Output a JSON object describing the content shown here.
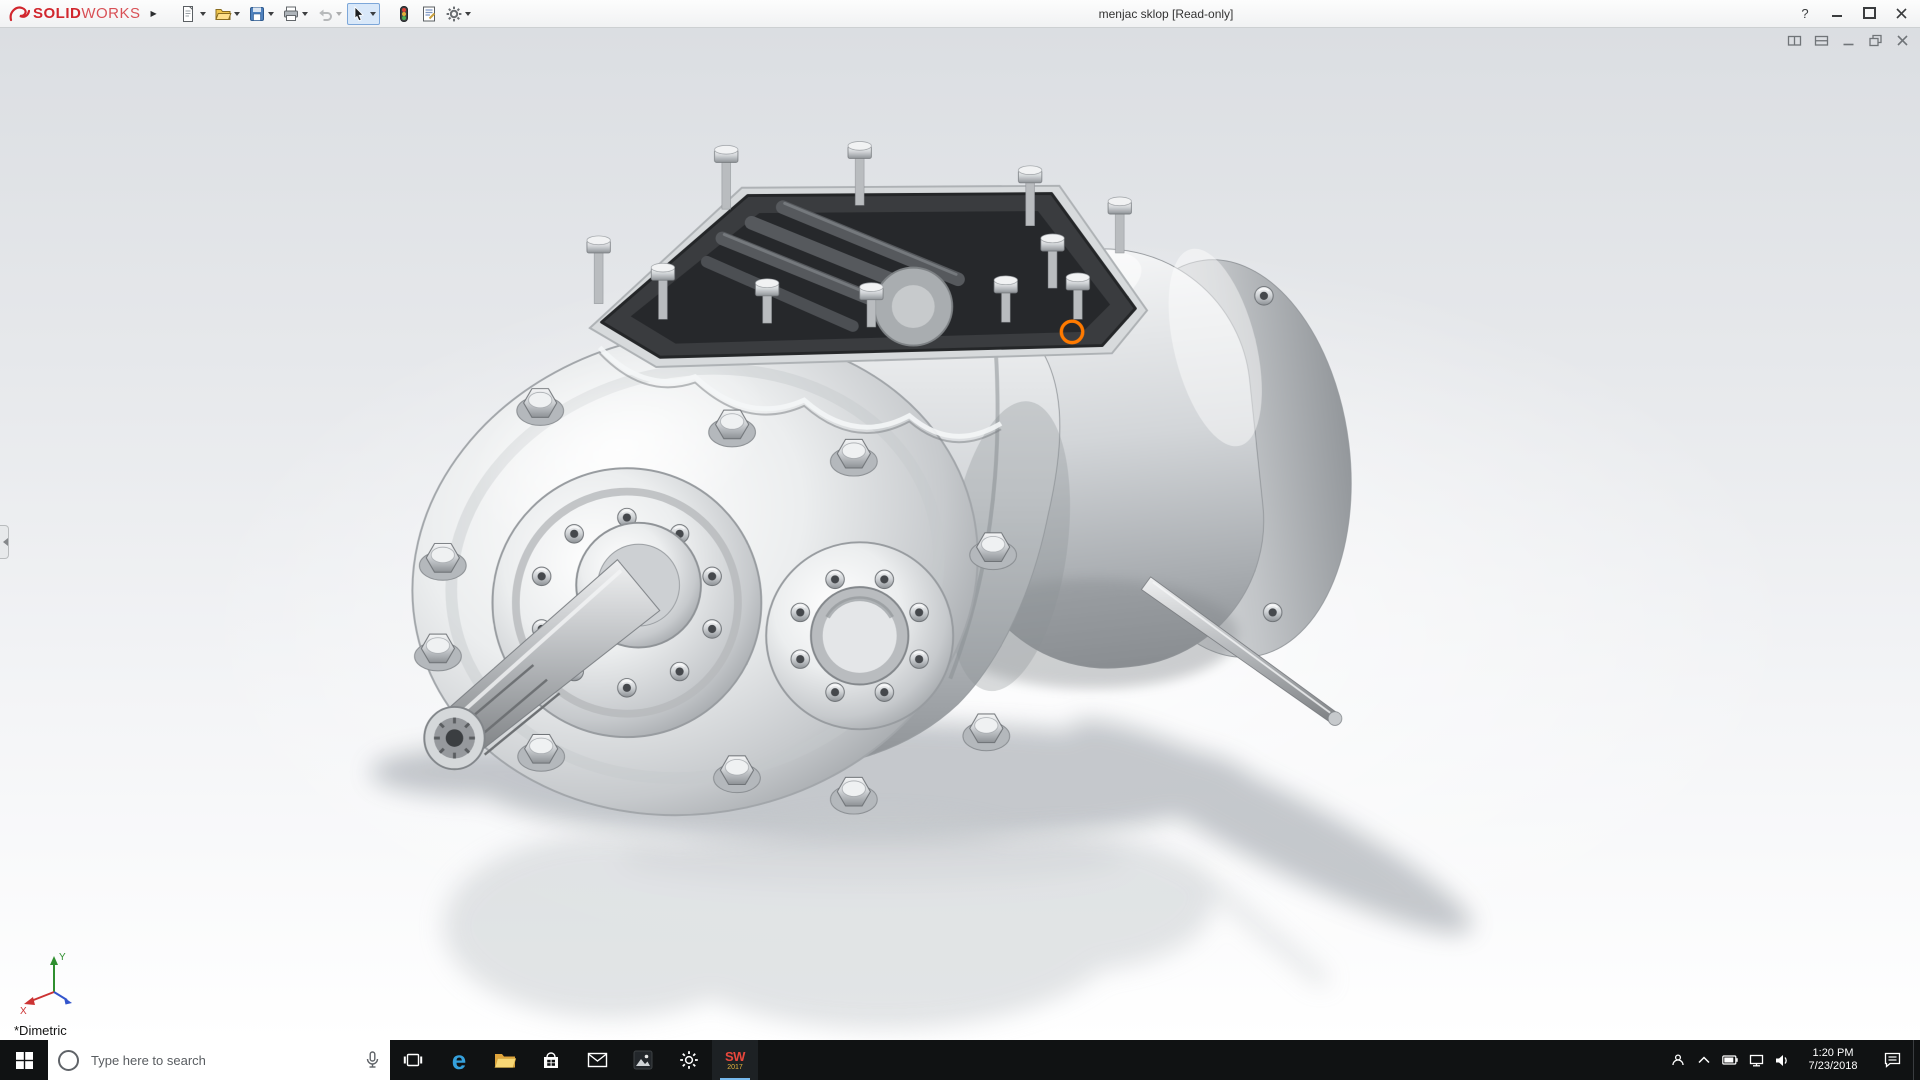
{
  "window": {
    "app_name_bold": "SOLID",
    "app_name_light": "WORKS",
    "flyout_glyph": "▶",
    "title": "menjac sklop [Read-only]",
    "help_glyph": "?"
  },
  "toolbar": {
    "items": [
      "new-document",
      "open",
      "save",
      "print",
      "undo",
      "select",
      "rebuild",
      "file-properties",
      "options"
    ]
  },
  "doc_controls": [
    "split-vertical",
    "split-horizontal",
    "minimize",
    "restore",
    "close"
  ],
  "viewport": {
    "view_label": "*Dimetric",
    "selection_color": "#ff7a00",
    "triad_x": "X",
    "triad_y": "Y"
  },
  "taskbar": {
    "search_placeholder": "Type here to search",
    "edge_glyph": "e",
    "apps": [
      "edge",
      "file-explorer",
      "store",
      "mail",
      "photos",
      "settings",
      "solidworks-2017"
    ],
    "solidworks_label": "SW",
    "solidworks_year": "2017",
    "time": "1:20 PM",
    "date": "7/23/2018"
  },
  "colors": {
    "accent_red": "#d1262d",
    "selection_orange": "#ff7a00",
    "taskbar_bg": "#101213"
  }
}
